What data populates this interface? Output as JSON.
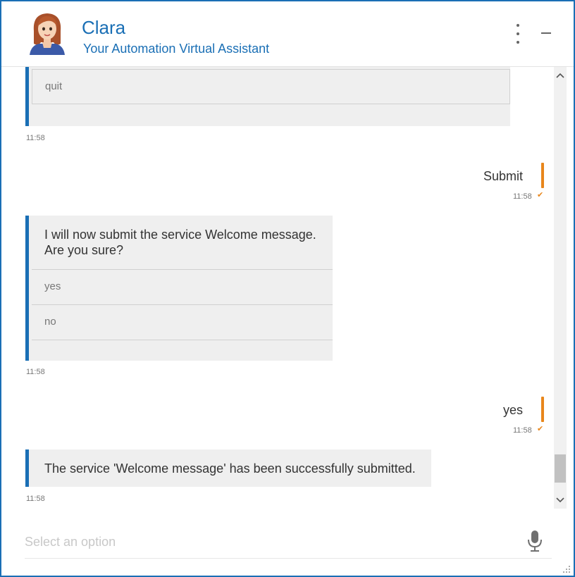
{
  "header": {
    "title": "Clara",
    "subtitle": "Your Automation Virtual Assistant"
  },
  "messages": {
    "msg1": {
      "option": "quit",
      "time": "11:58"
    },
    "msg2": {
      "text": "Submit",
      "time": "11:58"
    },
    "msg3": {
      "line1": "I will now submit the service Welcome message.",
      "line2": "Are you sure?",
      "options": [
        "yes",
        "no"
      ],
      "time": "11:58"
    },
    "msg4": {
      "text": "yes",
      "time": "11:58"
    },
    "msg5": {
      "text": "The service 'Welcome message' has been successfully submitted.",
      "time": "11:58"
    }
  },
  "input": {
    "placeholder": "Select an option",
    "value": ""
  },
  "colors": {
    "brand": "#1a6fb5",
    "user_accent": "#e8861b",
    "bubble": "#efefef"
  },
  "icons": {
    "menu": "more-vert-icon",
    "minimize": "minimize-icon",
    "mic": "mic-icon",
    "scroll_up": "chevron-up-icon",
    "scroll_down": "chevron-down-icon",
    "read": "double-check-icon"
  }
}
